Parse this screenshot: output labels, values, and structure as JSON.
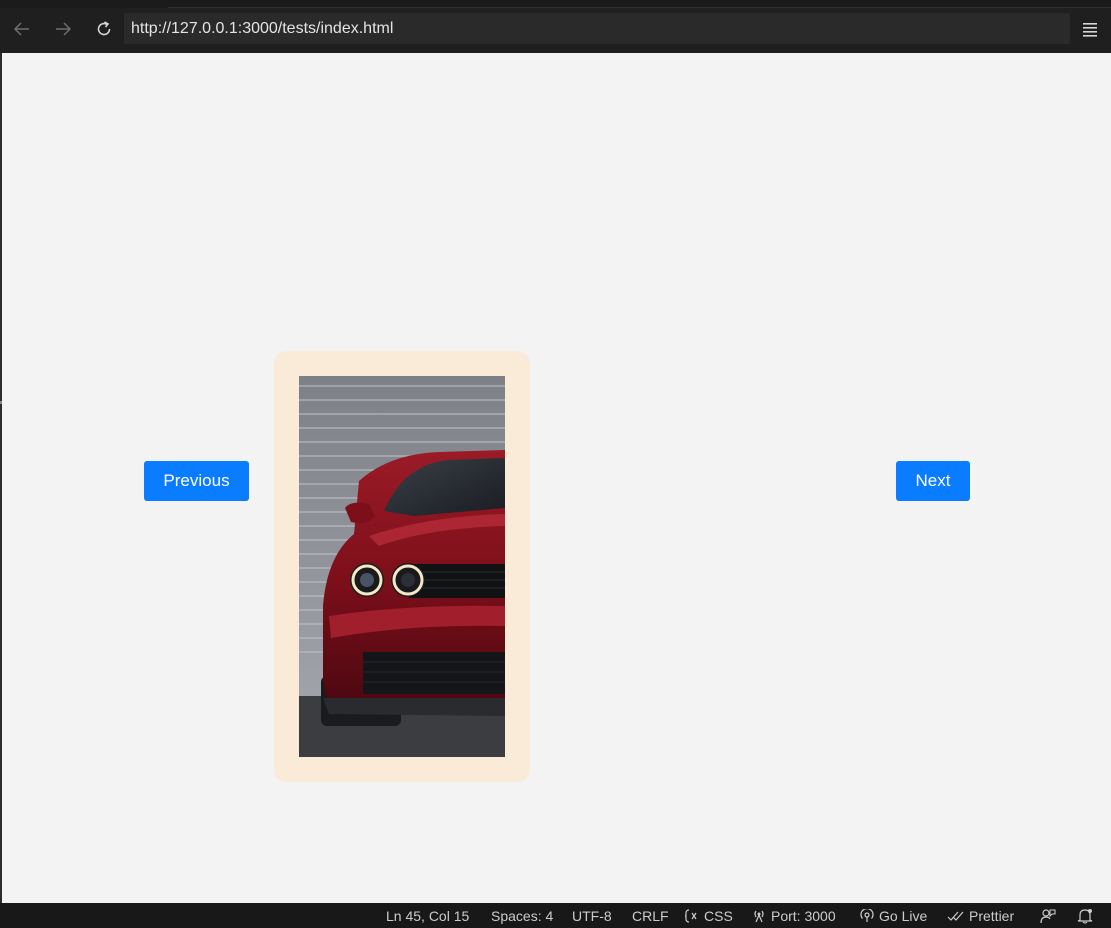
{
  "browser": {
    "url": "http://127.0.0.1:3000/tests/index.html",
    "back_icon": "arrow-left-icon",
    "forward_icon": "arrow-right-icon",
    "reload_icon": "reload-icon",
    "menu_icon": "hamburger-menu-icon"
  },
  "page": {
    "prev_label": "Previous",
    "next_label": "Next",
    "accent_color": "#0a7cff",
    "card_color": "#faebd8",
    "background_color": "#f3f3f3"
  },
  "status": {
    "position": "Ln 45, Col 15",
    "spaces": "Spaces: 4",
    "encoding": "UTF-8",
    "eol": "CRLF",
    "language": "CSS",
    "port": "Port: 3000",
    "go_live": "Go Live",
    "prettier": "Prettier"
  }
}
